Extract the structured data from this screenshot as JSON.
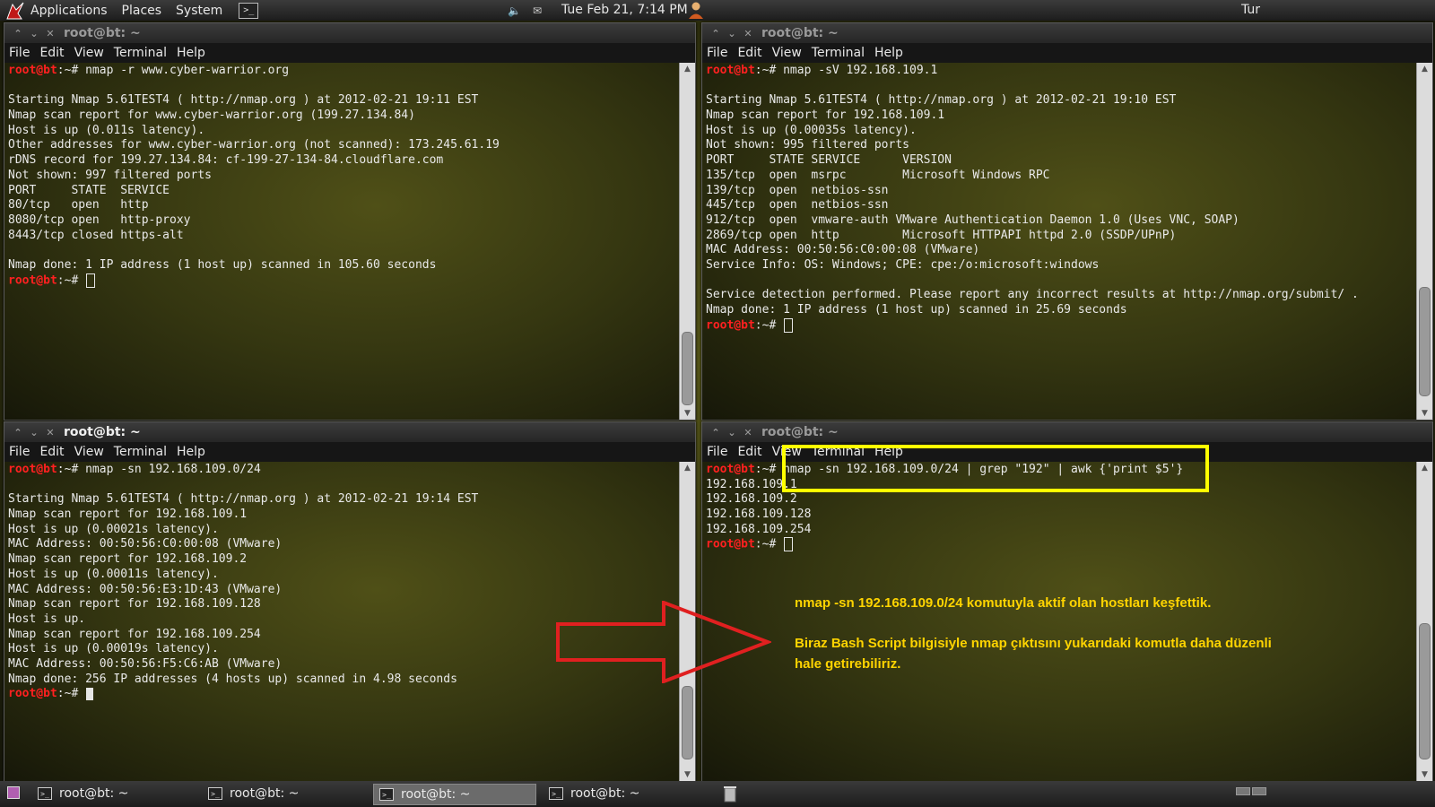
{
  "top_panel": {
    "menus": [
      "Applications",
      "Places",
      "System"
    ],
    "clock": "Tue Feb 21,  7:14 PM",
    "keyboard_layout": "Tur"
  },
  "prompt": {
    "user": "root@bt",
    "suffix": ":~# "
  },
  "menubar_items": [
    "File",
    "Edit",
    "View",
    "Terminal",
    "Help"
  ],
  "windows": [
    {
      "title": "root@bt: ~",
      "active": false,
      "lines": [
        {
          "prompt": true,
          "text": "nmap -r www.cyber-warrior.org"
        },
        {
          "text": ""
        },
        {
          "text": "Starting Nmap 5.61TEST4 ( http://nmap.org ) at 2012-02-21 19:11 EST"
        },
        {
          "text": "Nmap scan report for www.cyber-warrior.org (199.27.134.84)"
        },
        {
          "text": "Host is up (0.011s latency)."
        },
        {
          "text": "Other addresses for www.cyber-warrior.org (not scanned): 173.245.61.19"
        },
        {
          "text": "rDNS record for 199.27.134.84: cf-199-27-134-84.cloudflare.com"
        },
        {
          "text": "Not shown: 997 filtered ports"
        },
        {
          "text": "PORT     STATE  SERVICE"
        },
        {
          "text": "80/tcp   open   http"
        },
        {
          "text": "8080/tcp open   http-proxy"
        },
        {
          "text": "8443/tcp closed https-alt"
        },
        {
          "text": ""
        },
        {
          "text": "Nmap done: 1 IP address (1 host up) scanned in 105.60 seconds"
        },
        {
          "prompt": true,
          "text": "",
          "cursor": "box"
        }
      ]
    },
    {
      "title": "root@bt: ~",
      "active": false,
      "lines": [
        {
          "prompt": true,
          "text": "nmap -sV 192.168.109.1"
        },
        {
          "text": ""
        },
        {
          "text": "Starting Nmap 5.61TEST4 ( http://nmap.org ) at 2012-02-21 19:10 EST"
        },
        {
          "text": "Nmap scan report for 192.168.109.1"
        },
        {
          "text": "Host is up (0.00035s latency)."
        },
        {
          "text": "Not shown: 995 filtered ports"
        },
        {
          "text": "PORT     STATE SERVICE      VERSION"
        },
        {
          "text": "135/tcp  open  msrpc        Microsoft Windows RPC"
        },
        {
          "text": "139/tcp  open  netbios-ssn"
        },
        {
          "text": "445/tcp  open  netbios-ssn"
        },
        {
          "text": "912/tcp  open  vmware-auth VMware Authentication Daemon 1.0 (Uses VNC, SOAP)"
        },
        {
          "text": "2869/tcp open  http         Microsoft HTTPAPI httpd 2.0 (SSDP/UPnP)"
        },
        {
          "text": "MAC Address: 00:50:56:C0:00:08 (VMware)"
        },
        {
          "text": "Service Info: OS: Windows; CPE: cpe:/o:microsoft:windows"
        },
        {
          "text": ""
        },
        {
          "text": "Service detection performed. Please report any incorrect results at http://nmap.org/submit/ ."
        },
        {
          "text": "Nmap done: 1 IP address (1 host up) scanned in 25.69 seconds"
        },
        {
          "prompt": true,
          "text": "",
          "cursor": "box"
        }
      ]
    },
    {
      "title": "root@bt: ~",
      "active": true,
      "lines": [
        {
          "prompt": true,
          "text": "nmap -sn 192.168.109.0/24"
        },
        {
          "text": ""
        },
        {
          "text": "Starting Nmap 5.61TEST4 ( http://nmap.org ) at 2012-02-21 19:14 EST"
        },
        {
          "text": "Nmap scan report for 192.168.109.1"
        },
        {
          "text": "Host is up (0.00021s latency)."
        },
        {
          "text": "MAC Address: 00:50:56:C0:00:08 (VMware)"
        },
        {
          "text": "Nmap scan report for 192.168.109.2"
        },
        {
          "text": "Host is up (0.00011s latency)."
        },
        {
          "text": "MAC Address: 00:50:56:E3:1D:43 (VMware)"
        },
        {
          "text": "Nmap scan report for 192.168.109.128"
        },
        {
          "text": "Host is up."
        },
        {
          "text": "Nmap scan report for 192.168.109.254"
        },
        {
          "text": "Host is up (0.00019s latency)."
        },
        {
          "text": "MAC Address: 00:50:56:F5:C6:AB (VMware)"
        },
        {
          "text": "Nmap done: 256 IP addresses (4 hosts up) scanned in 4.98 seconds"
        },
        {
          "prompt": true,
          "text": "",
          "cursor": "solid"
        }
      ]
    },
    {
      "title": "root@bt: ~",
      "active": false,
      "lines": [
        {
          "prompt": true,
          "text": "nmap -sn 192.168.109.0/24 | grep \"192\" | awk {'print $5'}"
        },
        {
          "text": "192.168.109.1"
        },
        {
          "text": "192.168.109.2"
        },
        {
          "text": "192.168.109.128"
        },
        {
          "text": "192.168.109.254"
        },
        {
          "prompt": true,
          "text": "",
          "cursor": "box"
        }
      ]
    }
  ],
  "annotations": {
    "note1": "nmap -sn 192.168.109.0/24 komutuyla aktif olan hostları keşfettik.",
    "note2_line1": "Biraz Bash Script bilgisiyle nmap çıktısını yukarıdaki komutla daha düzenli",
    "note2_line2": "hale getirebiliriz.",
    "highlight_color": "#ffff00",
    "arrow_color": "#e02020",
    "note_color": "#ffd400"
  },
  "taskbar": {
    "tasks": [
      "root@bt: ~",
      "root@bt: ~",
      "root@bt: ~",
      "root@bt: ~"
    ],
    "active_index": 2
  },
  "colors": {
    "prompt_red": "#ff2020",
    "terminal_text": "#e9e9e9"
  }
}
